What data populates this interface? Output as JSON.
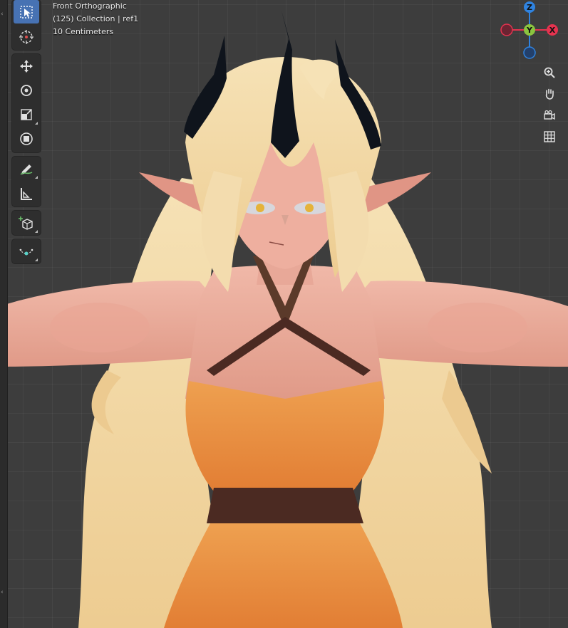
{
  "viewport": {
    "view_name": "Front Orthographic",
    "collection_info": "(125) Collection | ref1",
    "grid_scale": "10 Centimeters"
  },
  "toolbar": {
    "tools": [
      {
        "icon": "select-box-icon",
        "active": true
      },
      {
        "icon": "cursor-icon",
        "active": false
      },
      {
        "icon": "move-icon",
        "active": false
      },
      {
        "icon": "rotate-icon",
        "active": false
      },
      {
        "icon": "scale-icon",
        "active": false
      },
      {
        "icon": "transform-icon",
        "active": false
      },
      {
        "icon": "annotate-icon",
        "active": false
      },
      {
        "icon": "measure-icon",
        "active": false
      },
      {
        "icon": "add-cube-icon",
        "active": false
      },
      {
        "icon": "extrude-curve-icon",
        "active": false
      }
    ]
  },
  "gizmo": {
    "z_label": "Z",
    "y_label": "Y",
    "x_label": "X",
    "colors": {
      "x": "#e5334f",
      "y": "#8bc43f",
      "z": "#2f83e0"
    }
  },
  "nav_buttons": [
    "zoom-icon",
    "pan-hand-icon",
    "camera-view-icon",
    "grid-perspective-icon"
  ],
  "colors": {
    "background": "#3d3d3d",
    "accent": "#4772b3",
    "skin": "#e8a898",
    "hair": "#f1d7a5",
    "dress": "#e8893a",
    "belt": "#4b2a22",
    "horns": "#0f141c"
  }
}
